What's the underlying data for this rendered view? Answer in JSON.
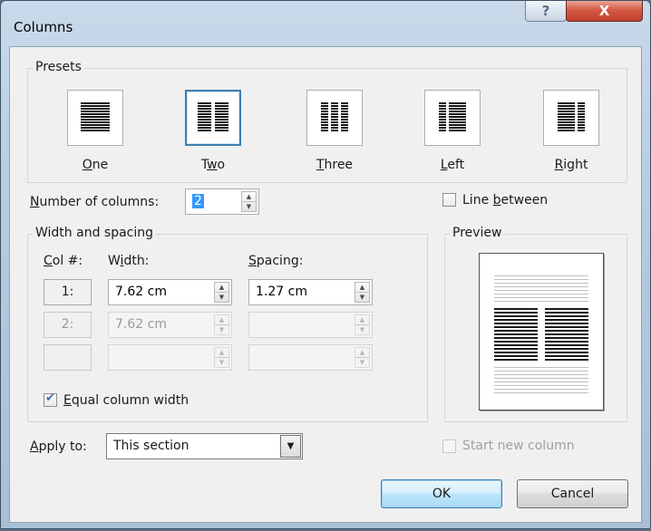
{
  "window": {
    "title": "Columns",
    "help_glyph": "?",
    "close_glyph": "X"
  },
  "presets": {
    "group_label": "Presets",
    "items": [
      {
        "id": "one",
        "mnemonic": "O",
        "rest": "ne",
        "icon": "one-column-icon",
        "selected": false
      },
      {
        "id": "two",
        "pre": "T",
        "mnemonic": "w",
        "rest": "o",
        "icon": "two-columns-icon",
        "selected": true
      },
      {
        "id": "three",
        "mnemonic": "T",
        "rest": "hree",
        "icon": "three-columns-icon",
        "selected": false
      },
      {
        "id": "left",
        "mnemonic": "L",
        "rest": "eft",
        "icon": "left-column-icon",
        "selected": false
      },
      {
        "id": "right",
        "mnemonic": "R",
        "rest": "ight",
        "icon": "right-column-icon",
        "selected": false
      }
    ]
  },
  "number_of_columns": {
    "mnemonic": "N",
    "rest": "umber of columns:",
    "value": "2"
  },
  "line_between": {
    "mnemonic": "b",
    "pre": "Line ",
    "rest": "etween",
    "checked": false
  },
  "width_spacing": {
    "group_label": "Width and spacing",
    "col_header_mnemonic": "C",
    "col_header_rest": "ol #:",
    "width_header_mnemonic": "i",
    "width_header_pre": "W",
    "width_header_rest": "dth:",
    "spacing_header_mnemonic": "S",
    "spacing_header_rest": "pacing:",
    "rows": [
      {
        "col": "1:",
        "width": "7.62 cm",
        "spacing": "1.27 cm",
        "enabled": true
      },
      {
        "col": "2:",
        "width": "7.62 cm",
        "spacing": "",
        "enabled": false
      },
      {
        "col": "",
        "width": "",
        "spacing": "",
        "enabled": false
      }
    ],
    "equal_width": {
      "mnemonic": "E",
      "rest": "qual column width",
      "checked": true
    }
  },
  "preview": {
    "label": "Preview"
  },
  "apply_to": {
    "mnemonic": "A",
    "rest": "pply to:",
    "value": "This section"
  },
  "start_new_column": {
    "label": "Start new column",
    "checked": false,
    "enabled": false
  },
  "buttons": {
    "ok": "OK",
    "cancel": "Cancel"
  },
  "colors": {
    "accent": "#3c7fb1",
    "close_red": "#c2412a",
    "titlebar": "#b6cbe0"
  }
}
